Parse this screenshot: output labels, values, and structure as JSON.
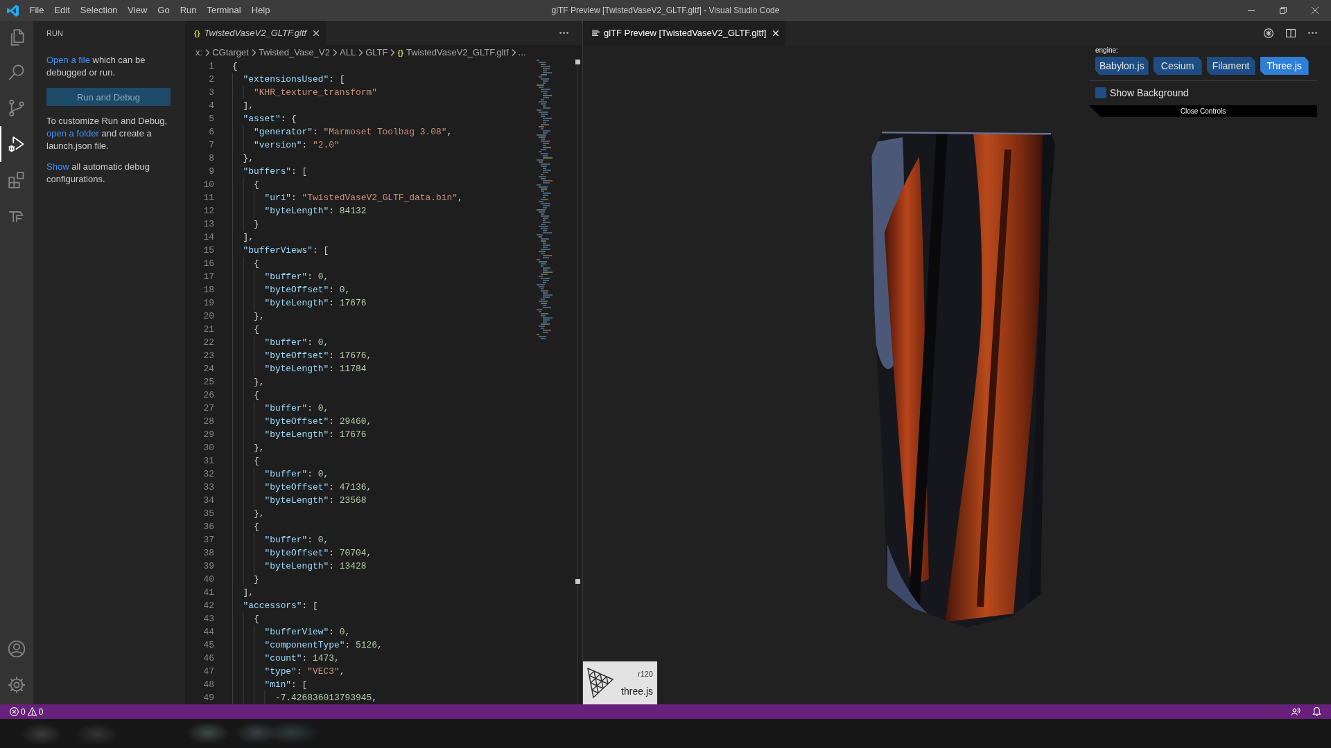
{
  "title_bar": {
    "menu": [
      "File",
      "Edit",
      "Selection",
      "View",
      "Go",
      "Run",
      "Terminal",
      "Help"
    ],
    "title": "glTF Preview [TwistedVaseV2_GLTF.gltf] - Visual Studio Code"
  },
  "activity_bar": {
    "top": [
      {
        "kind": "explorer",
        "selected": false
      },
      {
        "kind": "search",
        "selected": false
      },
      {
        "kind": "source_control",
        "selected": false
      },
      {
        "kind": "run",
        "selected": true
      },
      {
        "kind": "extensions",
        "selected": false
      },
      {
        "kind": "custom",
        "selected": false
      }
    ],
    "bottom": [
      {
        "kind": "account"
      },
      {
        "kind": "settings"
      }
    ]
  },
  "sidebar": {
    "title": "RUN",
    "intro": [
      {
        "text": "Open a file",
        "link": true
      },
      {
        "text": "which can be debugged or run.",
        "link": false
      }
    ],
    "button": "Run and Debug",
    "paragraphs": [
      [
        {
          "text": "To customize Run and Debug,",
          "link": false
        },
        {
          "text": "open a folder",
          "link": true
        },
        {
          "text": "and create a launch.json file.",
          "link": false
        }
      ],
      [
        {
          "text": "Show",
          "link": true
        },
        {
          "text": "all automatic debug configurations.",
          "link": false
        }
      ]
    ]
  },
  "editor": {
    "tab": {
      "icon": "{}",
      "label": "TwistedVaseV2_GLTF.gltf",
      "selected": true,
      "preview": true
    },
    "breadcrumb": [
      {
        "label": "x:"
      },
      {
        "label": "CGtarget"
      },
      {
        "label": "Twisted_Vase_V2"
      },
      {
        "label": "ALL"
      },
      {
        "label": "GLTF"
      },
      {
        "icon": "{}",
        "label": "TwistedVaseV2_GLTF.gltf"
      },
      {
        "label": "..."
      }
    ],
    "lines": [
      {
        "number": "1",
        "tokens": [
          {
            "kind": "punct",
            "text": "{"
          }
        ]
      },
      {
        "number": "2",
        "tokens": [
          {
            "kind": "key",
            "text": "  \"extensionsUsed\""
          },
          {
            "kind": "punct",
            "text": ": ["
          }
        ]
      },
      {
        "number": "3",
        "tokens": [
          {
            "kind": "string",
            "text": "    \"KHR_texture_transform\""
          }
        ]
      },
      {
        "number": "4",
        "tokens": [
          {
            "kind": "punct",
            "text": "  ],"
          }
        ]
      },
      {
        "number": "5",
        "tokens": [
          {
            "kind": "key",
            "text": "  \"asset\""
          },
          {
            "kind": "punct",
            "text": ": {"
          }
        ]
      },
      {
        "number": "6",
        "tokens": [
          {
            "kind": "key",
            "text": "    \"generator\""
          },
          {
            "kind": "punct",
            "text": ": "
          },
          {
            "kind": "string",
            "text": "\"Marmoset Toolbag 3.08\""
          },
          {
            "kind": "punct",
            "text": ","
          }
        ]
      },
      {
        "number": "7",
        "tokens": [
          {
            "kind": "key",
            "text": "    \"version\""
          },
          {
            "kind": "punct",
            "text": ": "
          },
          {
            "kind": "string",
            "text": "\"2.0\""
          }
        ]
      },
      {
        "number": "8",
        "tokens": [
          {
            "kind": "punct",
            "text": "  },"
          }
        ]
      },
      {
        "number": "9",
        "tokens": [
          {
            "kind": "key",
            "text": "  \"buffers\""
          },
          {
            "kind": "punct",
            "text": ": ["
          }
        ]
      },
      {
        "number": "10",
        "tokens": [
          {
            "kind": "punct",
            "text": "    {"
          }
        ]
      },
      {
        "number": "11",
        "tokens": [
          {
            "kind": "key",
            "text": "      \"uri\""
          },
          {
            "kind": "punct",
            "text": ": "
          },
          {
            "kind": "string",
            "text": "\"TwistedVaseV2_GLTF_data.bin\""
          },
          {
            "kind": "punct",
            "text": ","
          }
        ]
      },
      {
        "number": "12",
        "tokens": [
          {
            "kind": "key",
            "text": "      \"byteLength\""
          },
          {
            "kind": "punct",
            "text": ": "
          },
          {
            "kind": "number",
            "text": "84132"
          }
        ]
      },
      {
        "number": "13",
        "tokens": [
          {
            "kind": "punct",
            "text": "    }"
          }
        ]
      },
      {
        "number": "14",
        "tokens": [
          {
            "kind": "punct",
            "text": "  ],"
          }
        ]
      },
      {
        "number": "15",
        "tokens": [
          {
            "kind": "key",
            "text": "  \"bufferViews\""
          },
          {
            "kind": "punct",
            "text": ": ["
          }
        ]
      },
      {
        "number": "16",
        "tokens": [
          {
            "kind": "punct",
            "text": "    {"
          }
        ]
      },
      {
        "number": "17",
        "tokens": [
          {
            "kind": "key",
            "text": "      \"buffer\""
          },
          {
            "kind": "punct",
            "text": ": "
          },
          {
            "kind": "number",
            "text": "0"
          },
          {
            "kind": "punct",
            "text": ","
          }
        ]
      },
      {
        "number": "18",
        "tokens": [
          {
            "kind": "key",
            "text": "      \"byteOffset\""
          },
          {
            "kind": "punct",
            "text": ": "
          },
          {
            "kind": "number",
            "text": "0"
          },
          {
            "kind": "punct",
            "text": ","
          }
        ]
      },
      {
        "number": "19",
        "tokens": [
          {
            "kind": "key",
            "text": "      \"byteLength\""
          },
          {
            "kind": "punct",
            "text": ": "
          },
          {
            "kind": "number",
            "text": "17676"
          }
        ]
      },
      {
        "number": "20",
        "tokens": [
          {
            "kind": "punct",
            "text": "    },"
          }
        ]
      },
      {
        "number": "21",
        "tokens": [
          {
            "kind": "punct",
            "text": "    {"
          }
        ]
      },
      {
        "number": "22",
        "tokens": [
          {
            "kind": "key",
            "text": "      \"buffer\""
          },
          {
            "kind": "punct",
            "text": ": "
          },
          {
            "kind": "number",
            "text": "0"
          },
          {
            "kind": "punct",
            "text": ","
          }
        ]
      },
      {
        "number": "23",
        "tokens": [
          {
            "kind": "key",
            "text": "      \"byteOffset\""
          },
          {
            "kind": "punct",
            "text": ": "
          },
          {
            "kind": "number",
            "text": "17676"
          },
          {
            "kind": "punct",
            "text": ","
          }
        ]
      },
      {
        "number": "24",
        "tokens": [
          {
            "kind": "key",
            "text": "      \"byteLength\""
          },
          {
            "kind": "punct",
            "text": ": "
          },
          {
            "kind": "number",
            "text": "11784"
          }
        ]
      },
      {
        "number": "25",
        "tokens": [
          {
            "kind": "punct",
            "text": "    },"
          }
        ]
      },
      {
        "number": "26",
        "tokens": [
          {
            "kind": "punct",
            "text": "    {"
          }
        ]
      },
      {
        "number": "27",
        "tokens": [
          {
            "kind": "key",
            "text": "      \"buffer\""
          },
          {
            "kind": "punct",
            "text": ": "
          },
          {
            "kind": "number",
            "text": "0"
          },
          {
            "kind": "punct",
            "text": ","
          }
        ]
      },
      {
        "number": "28",
        "tokens": [
          {
            "kind": "key",
            "text": "      \"byteOffset\""
          },
          {
            "kind": "punct",
            "text": ": "
          },
          {
            "kind": "number",
            "text": "29460"
          },
          {
            "kind": "punct",
            "text": ","
          }
        ]
      },
      {
        "number": "29",
        "tokens": [
          {
            "kind": "key",
            "text": "      \"byteLength\""
          },
          {
            "kind": "punct",
            "text": ": "
          },
          {
            "kind": "number",
            "text": "17676"
          }
        ]
      },
      {
        "number": "30",
        "tokens": [
          {
            "kind": "punct",
            "text": "    },"
          }
        ]
      },
      {
        "number": "31",
        "tokens": [
          {
            "kind": "punct",
            "text": "    {"
          }
        ]
      },
      {
        "number": "32",
        "tokens": [
          {
            "kind": "key",
            "text": "      \"buffer\""
          },
          {
            "kind": "punct",
            "text": ": "
          },
          {
            "kind": "number",
            "text": "0"
          },
          {
            "kind": "punct",
            "text": ","
          }
        ]
      },
      {
        "number": "33",
        "tokens": [
          {
            "kind": "key",
            "text": "      \"byteOffset\""
          },
          {
            "kind": "punct",
            "text": ": "
          },
          {
            "kind": "number",
            "text": "47136"
          },
          {
            "kind": "punct",
            "text": ","
          }
        ]
      },
      {
        "number": "34",
        "tokens": [
          {
            "kind": "key",
            "text": "      \"byteLength\""
          },
          {
            "kind": "punct",
            "text": ": "
          },
          {
            "kind": "number",
            "text": "23568"
          }
        ]
      },
      {
        "number": "35",
        "tokens": [
          {
            "kind": "punct",
            "text": "    },"
          }
        ]
      },
      {
        "number": "36",
        "tokens": [
          {
            "kind": "punct",
            "text": "    {"
          }
        ]
      },
      {
        "number": "37",
        "tokens": [
          {
            "kind": "key",
            "text": "      \"buffer\""
          },
          {
            "kind": "punct",
            "text": ": "
          },
          {
            "kind": "number",
            "text": "0"
          },
          {
            "kind": "punct",
            "text": ","
          }
        ]
      },
      {
        "number": "38",
        "tokens": [
          {
            "kind": "key",
            "text": "      \"byteOffset\""
          },
          {
            "kind": "punct",
            "text": ": "
          },
          {
            "kind": "number",
            "text": "70704"
          },
          {
            "kind": "punct",
            "text": ","
          }
        ]
      },
      {
        "number": "39",
        "tokens": [
          {
            "kind": "key",
            "text": "      \"byteLength\""
          },
          {
            "kind": "punct",
            "text": ": "
          },
          {
            "kind": "number",
            "text": "13428"
          }
        ]
      },
      {
        "number": "40",
        "tokens": [
          {
            "kind": "punct",
            "text": "    }"
          }
        ]
      },
      {
        "number": "41",
        "tokens": [
          {
            "kind": "punct",
            "text": "  ],"
          }
        ]
      },
      {
        "number": "42",
        "tokens": [
          {
            "kind": "key",
            "text": "  \"accessors\""
          },
          {
            "kind": "punct",
            "text": ": ["
          }
        ]
      },
      {
        "number": "43",
        "tokens": [
          {
            "kind": "punct",
            "text": "    {"
          }
        ]
      },
      {
        "number": "44",
        "tokens": [
          {
            "kind": "key",
            "text": "      \"bufferView\""
          },
          {
            "kind": "punct",
            "text": ": "
          },
          {
            "kind": "number",
            "text": "0"
          },
          {
            "kind": "punct",
            "text": ","
          }
        ]
      },
      {
        "number": "45",
        "tokens": [
          {
            "kind": "key",
            "text": "      \"componentType\""
          },
          {
            "kind": "punct",
            "text": ": "
          },
          {
            "kind": "number",
            "text": "5126"
          },
          {
            "kind": "punct",
            "text": ","
          }
        ]
      },
      {
        "number": "46",
        "tokens": [
          {
            "kind": "key",
            "text": "      \"count\""
          },
          {
            "kind": "punct",
            "text": ": "
          },
          {
            "kind": "number",
            "text": "1473"
          },
          {
            "kind": "punct",
            "text": ","
          }
        ]
      },
      {
        "number": "47",
        "tokens": [
          {
            "kind": "key",
            "text": "      \"type\""
          },
          {
            "kind": "punct",
            "text": ": "
          },
          {
            "kind": "string",
            "text": "\"VEC3\""
          },
          {
            "kind": "punct",
            "text": ","
          }
        ]
      },
      {
        "number": "48",
        "tokens": [
          {
            "kind": "key",
            "text": "      \"min\""
          },
          {
            "kind": "punct",
            "text": ": ["
          }
        ]
      },
      {
        "number": "49",
        "tokens": [
          {
            "kind": "number",
            "text": "        -7.426836013793945"
          },
          {
            "kind": "punct",
            "text": ","
          }
        ]
      }
    ]
  },
  "preview": {
    "tab": {
      "label": "glTF Preview [TwistedVaseV2_GLTF.gltf]",
      "selected": true,
      "preview": false
    },
    "controls": {
      "engine_label": "engine:",
      "engines": [
        {
          "label": "Babylon.js",
          "selected": false
        },
        {
          "label": "Cesium",
          "selected": false
        },
        {
          "label": "Filament",
          "selected": false
        },
        {
          "label": "Three.js",
          "selected": true
        }
      ],
      "show_background": {
        "label": "Show Background",
        "checked": false
      },
      "close_button": "Close Controls"
    },
    "renderer_badge": {
      "version": "r120",
      "name": "three.js"
    }
  },
  "status_bar": {
    "errors": "0",
    "warnings": "0"
  }
}
